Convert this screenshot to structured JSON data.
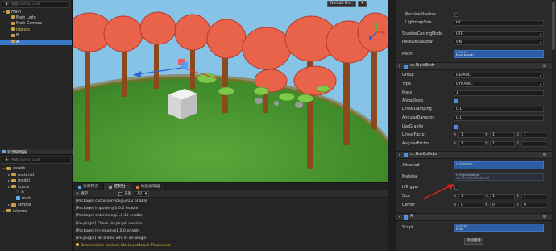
{
  "hierarchy": {
    "search_placeholder": "搜索 name, uuid",
    "nodes": [
      {
        "label": "main",
        "depth": 0,
        "expanded": true,
        "state": "normal"
      },
      {
        "label": "Main Light",
        "depth": 1,
        "state": "normal"
      },
      {
        "label": "Main Camera",
        "depth": 1,
        "state": "normal"
      },
      {
        "label": "islands",
        "depth": 1,
        "state": "islands"
      },
      {
        "label": "B",
        "depth": 1,
        "state": "normal"
      },
      {
        "label": "A",
        "depth": 1,
        "state": "selected"
      }
    ]
  },
  "assets": {
    "title": "资源管理器",
    "search_placeholder": "搜索 name, uuid",
    "items": [
      {
        "label": "assets",
        "depth": 0,
        "icon": "folder"
      },
      {
        "label": "material",
        "depth": 1,
        "icon": "folder"
      },
      {
        "label": "model",
        "depth": 1,
        "icon": "folder"
      },
      {
        "label": "scene",
        "depth": 1,
        "icon": "folder"
      },
      {
        "label": "A",
        "depth": 2,
        "icon": "ts"
      },
      {
        "label": "main",
        "depth": 2,
        "icon": "scene"
      },
      {
        "label": "skybox",
        "depth": 1,
        "icon": "folder"
      },
      {
        "label": "internal",
        "depth": 0,
        "icon": "folder"
      }
    ]
  },
  "viewport": {
    "shading_mode": "Default Dir..."
  },
  "console": {
    "tabs": [
      "资源预览",
      "控制台",
      "动画编辑器"
    ],
    "active_tab": 1,
    "clear_label": "清空",
    "regex_label": "正则",
    "filter_value": "All",
    "logs": [
      {
        "text": "[Package] cocos-service@3.0.2 enable",
        "level": "info"
      },
      {
        "text": "[Package] importer@1.0.0 enable",
        "level": "info"
      },
      {
        "text": "[Package] extension@1.0.15 enable",
        "level": "info"
      },
      {
        "text": "[im-plugin] Check im-plugin version.",
        "level": "info"
      },
      {
        "text": "[Package] im-plugin@1.0.0 enable",
        "level": "info"
      },
      {
        "text": "[im-plugin] No online info of im-plugin.",
        "level": "info"
      },
      {
        "text": "Browserslist: caniuse-lite is outdated. Please run",
        "level": "warn"
      }
    ]
  },
  "inspector": {
    "receive_shadow_label": "ReceiveShadow",
    "lightmap_size_label": "LightmapSize",
    "lightmap_size_value": "64",
    "shadow_casting_label": "ShadowCastingMode",
    "shadow_casting_value": "OFF",
    "receive_shadow2_label": "ReceiveShadow",
    "receive_shadow2_value": "ON",
    "mesh_label": "Mesh",
    "mesh_type": "cc.Mesh",
    "mesh_value": "box.mesh",
    "rigidbody_name": "cc.RigidBody",
    "group_label": "Group",
    "group_value": "DEFAULT",
    "type_label": "Type",
    "type_value": "DYNAMIC",
    "mass_label": "Mass",
    "mass_value": "1",
    "allow_sleep_label": "AllowSleep",
    "linear_damping_label": "LinearDamping",
    "linear_damping_value": "0.1",
    "angular_damping_label": "AngularDamping",
    "angular_damping_value": "0.1",
    "use_gravity_label": "UseGravity",
    "linear_factor_label": "LinearFactor",
    "linear_factor": [
      "1",
      "1",
      "1"
    ],
    "angular_factor_label": "AngularFactor",
    "angular_factor": [
      "1",
      "1",
      "1"
    ],
    "boxcollider_name": "cc.BoxCollider",
    "attached_label": "Attached",
    "attached_type": "cc.RigidBody",
    "material_label": "Material",
    "material_type": "cc.PhysicsMaterial",
    "material_value": "cc.PhysicsMaterial",
    "is_trigger_label": "IsTrigger",
    "size_label": "Size",
    "size": [
      "1",
      "1",
      "1"
    ],
    "center_label": "Center",
    "center": [
      "0",
      "0",
      "0"
    ],
    "script_comp_name": "A",
    "script_label": "Script",
    "script_type": "cc.Script",
    "script_value": "A.ts",
    "add_component_label": "添加组件"
  },
  "colors": {
    "selection": "#3a78c9",
    "accent_blue": "#2d5da3",
    "warning": "#e6c23a",
    "annotation_arrow": "#e02020"
  }
}
